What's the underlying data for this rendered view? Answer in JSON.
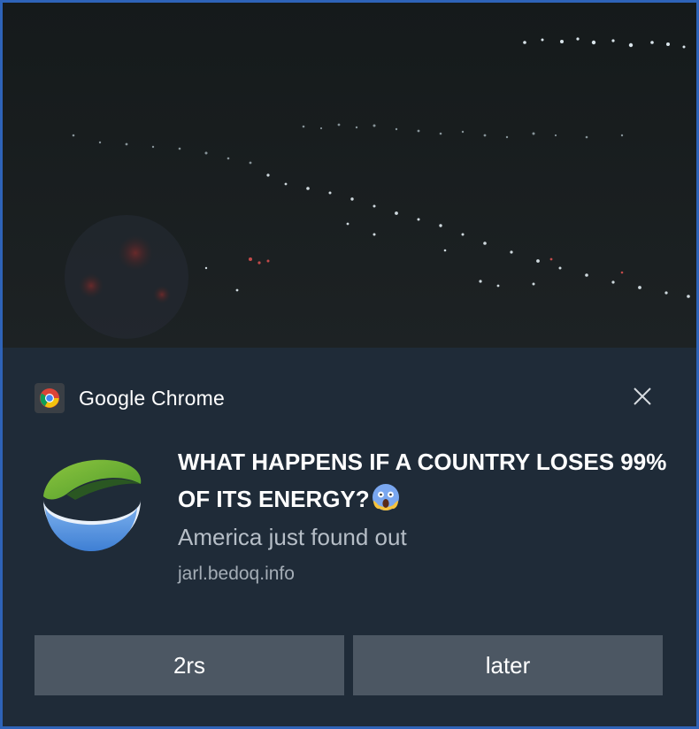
{
  "notification": {
    "app_name": "Google Chrome",
    "title": "WHAT HAPPENS IF A COUNTRY LOSES 99% OF ITS ENERGY?",
    "title_emoji": "face-screaming-in-fear",
    "body": "America just found out",
    "source": "jarl.bedoq.info",
    "close_icon": "close-icon"
  },
  "actions": [
    {
      "label": "2rs"
    },
    {
      "label": "later"
    }
  ],
  "colors": {
    "window_border": "#2e63b8",
    "panel_background": "#1f2b38",
    "button_background": "#4c5763",
    "body_text": "#b6bec7"
  }
}
